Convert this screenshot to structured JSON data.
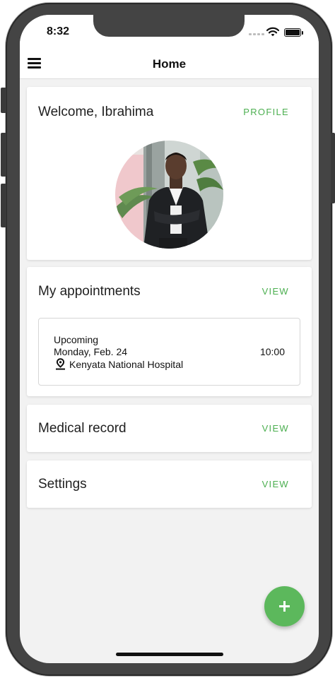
{
  "status_bar": {
    "time": "8:32",
    "icons": [
      "signal-dots-icon",
      "wifi-icon",
      "battery-icon"
    ]
  },
  "nav": {
    "title": "Home",
    "menu_icon": "hamburger-menu-icon"
  },
  "welcome_card": {
    "title": "Welcome, Ibrahima",
    "action": "PROFILE",
    "avatar": "profile-photo"
  },
  "appointments_card": {
    "title": "My appointments",
    "action": "VIEW",
    "appointment": {
      "status": "Upcoming",
      "date": "Monday, Feb. 24",
      "location": "Kenyata National Hospital",
      "time": "10:00",
      "location_icon": "map-pin-icon"
    }
  },
  "medical_card": {
    "title": "Medical record",
    "action": "VIEW"
  },
  "settings_card": {
    "title": "Settings",
    "action": "VIEW"
  },
  "fab": {
    "icon": "plus-icon"
  },
  "colors": {
    "accent": "#4caf50",
    "fab": "#5cb85c",
    "background": "#f2f2f2",
    "frame": "#444444"
  }
}
